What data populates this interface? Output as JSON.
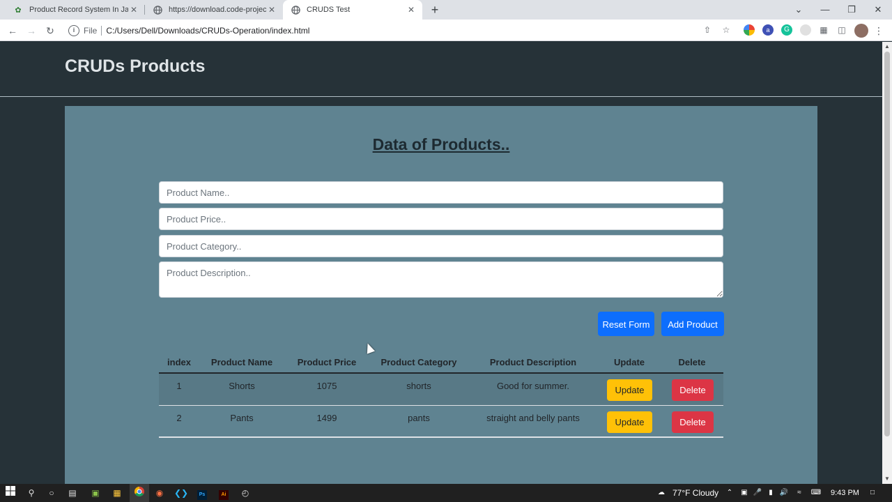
{
  "browser": {
    "tabs": [
      {
        "title": "Product Record System In JavaSc",
        "icon": "leaf-icon"
      },
      {
        "title": "https://download.code-projects.o",
        "icon": "globe-icon"
      },
      {
        "title": "CRUDS Test",
        "icon": "globe-icon"
      }
    ],
    "active_tab": 2,
    "address": {
      "protocol": "File",
      "url": "C:/Users/Dell/Downloads/CRUDs-Operation/index.html"
    }
  },
  "page": {
    "brand": "CRUDs Products",
    "title": "Data of Products..",
    "form": {
      "name_placeholder": "Product Name..",
      "price_placeholder": "Product Price..",
      "category_placeholder": "Product Category..",
      "description_placeholder": "Product Description..",
      "reset_label": "Reset Form",
      "add_label": "Add Product"
    },
    "table": {
      "headers": [
        "index",
        "Product Name",
        "Product Price",
        "Product Category",
        "Product Description",
        "Update",
        "Delete"
      ],
      "rows": [
        {
          "index": "1",
          "name": "Shorts",
          "price": "1075",
          "category": "shorts",
          "description": "Good for summer.",
          "update": "Update",
          "delete": "Delete"
        },
        {
          "index": "2",
          "name": "Pants",
          "price": "1499",
          "category": "pants",
          "description": "straight and belly pants",
          "update": "Update",
          "delete": "Delete"
        }
      ]
    }
  },
  "taskbar": {
    "weather": "77°F  Cloudy",
    "time": "9:43 PM"
  },
  "colors": {
    "page_bg": "#263238",
    "panel_bg": "#5f8391",
    "primary": "#0d6efd",
    "warning": "#ffc107",
    "danger": "#dc3545"
  }
}
